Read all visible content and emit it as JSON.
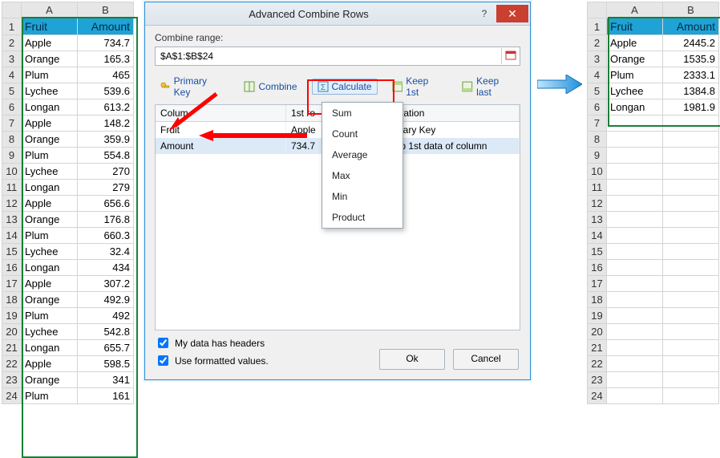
{
  "left_sheet": {
    "headers": [
      "Fruit",
      "Amount"
    ],
    "col_letters": [
      "A",
      "B"
    ],
    "rows": [
      [
        "Apple",
        "734.7"
      ],
      [
        "Orange",
        "165.3"
      ],
      [
        "Plum",
        "465"
      ],
      [
        "Lychee",
        "539.6"
      ],
      [
        "Longan",
        "613.2"
      ],
      [
        "Apple",
        "148.2"
      ],
      [
        "Orange",
        "359.9"
      ],
      [
        "Plum",
        "554.8"
      ],
      [
        "Lychee",
        "270"
      ],
      [
        "Longan",
        "279"
      ],
      [
        "Apple",
        "656.6"
      ],
      [
        "Orange",
        "176.8"
      ],
      [
        "Plum",
        "660.3"
      ],
      [
        "Lychee",
        "32.4"
      ],
      [
        "Longan",
        "434"
      ],
      [
        "Apple",
        "307.2"
      ],
      [
        "Orange",
        "492.9"
      ],
      [
        "Plum",
        "492"
      ],
      [
        "Lychee",
        "542.8"
      ],
      [
        "Longan",
        "655.7"
      ],
      [
        "Apple",
        "598.5"
      ],
      [
        "Orange",
        "341"
      ],
      [
        "Plum",
        "161"
      ]
    ]
  },
  "right_sheet": {
    "headers": [
      "Fruit",
      "Amount"
    ],
    "col_letters": [
      "A",
      "B"
    ],
    "rows": [
      [
        "Apple",
        "2445.2"
      ],
      [
        "Orange",
        "1535.9"
      ],
      [
        "Plum",
        "2333.1"
      ],
      [
        "Lychee",
        "1384.8"
      ],
      [
        "Longan",
        "1981.9"
      ]
    ],
    "empty_rows": 18
  },
  "dialog": {
    "title": "Advanced Combine Rows",
    "help": "?",
    "close": "✕",
    "combine_range_label": "Combine range:",
    "range_value": "$A$1:$B$24",
    "toolbar": {
      "primary_key": "Primary Key",
      "combine": "Combine",
      "calculate": "Calculate",
      "keep_1st": "Keep 1st",
      "keep_last": "Keep last"
    },
    "grid": {
      "col_column": "Colum",
      "col_1st": "1st ro",
      "col_op": "peration",
      "rows": [
        {
          "column": "Fruit",
          "first": "Apple",
          "op": "rimary Key"
        },
        {
          "column": "Amount",
          "first": "734.7",
          "op": "eep 1st data of column"
        }
      ]
    },
    "dropdown": [
      "Sum",
      "Count",
      "Average",
      "Max",
      "Min",
      "Product"
    ],
    "check_headers": "My data has headers",
    "check_formatted": "Use formatted values.",
    "ok": "Ok",
    "cancel": "Cancel"
  }
}
